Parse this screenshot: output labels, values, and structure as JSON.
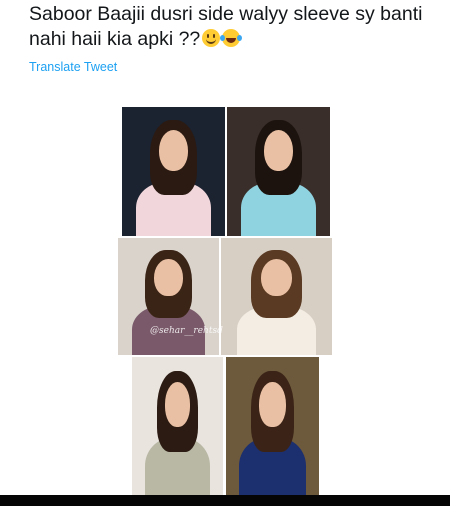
{
  "tweet": {
    "text": "Saboor Baajii dusri side walyy sleeve sy banti nahi haii kia apki ??",
    "emoji_1": "slightly-smiling-face-icon",
    "emoji_2": "face-with-tears-of-joy-icon",
    "translate_label": "Translate Tweet"
  },
  "photos": [
    {
      "name": "collage-photo-1",
      "bg": "#1b2230",
      "hair": "#2a1a12",
      "outfit": "#f1d7dc"
    },
    {
      "name": "collage-photo-2",
      "bg": "#3a2e2a",
      "hair": "#1d130e",
      "outfit": "#8fd3e0"
    },
    {
      "name": "collage-photo-3",
      "bg": "#d9d3cc",
      "hair": "#3a2416",
      "outfit": "#7a5a6a"
    },
    {
      "name": "collage-photo-4",
      "bg": "#d8cfc4",
      "hair": "#5a3a22",
      "outfit": "#f3ede3"
    },
    {
      "name": "collage-photo-5",
      "bg": "#e9e4de",
      "hair": "#2b1b12",
      "outfit": "#b8b8a4"
    },
    {
      "name": "collage-photo-6",
      "bg": "#6d5a3c",
      "hair": "#3b2417",
      "outfit": "#1c2f6e"
    }
  ],
  "watermark_text": "@sehar__rehtsd",
  "colors": {
    "link": "#1da1f2",
    "text": "#14171a"
  }
}
